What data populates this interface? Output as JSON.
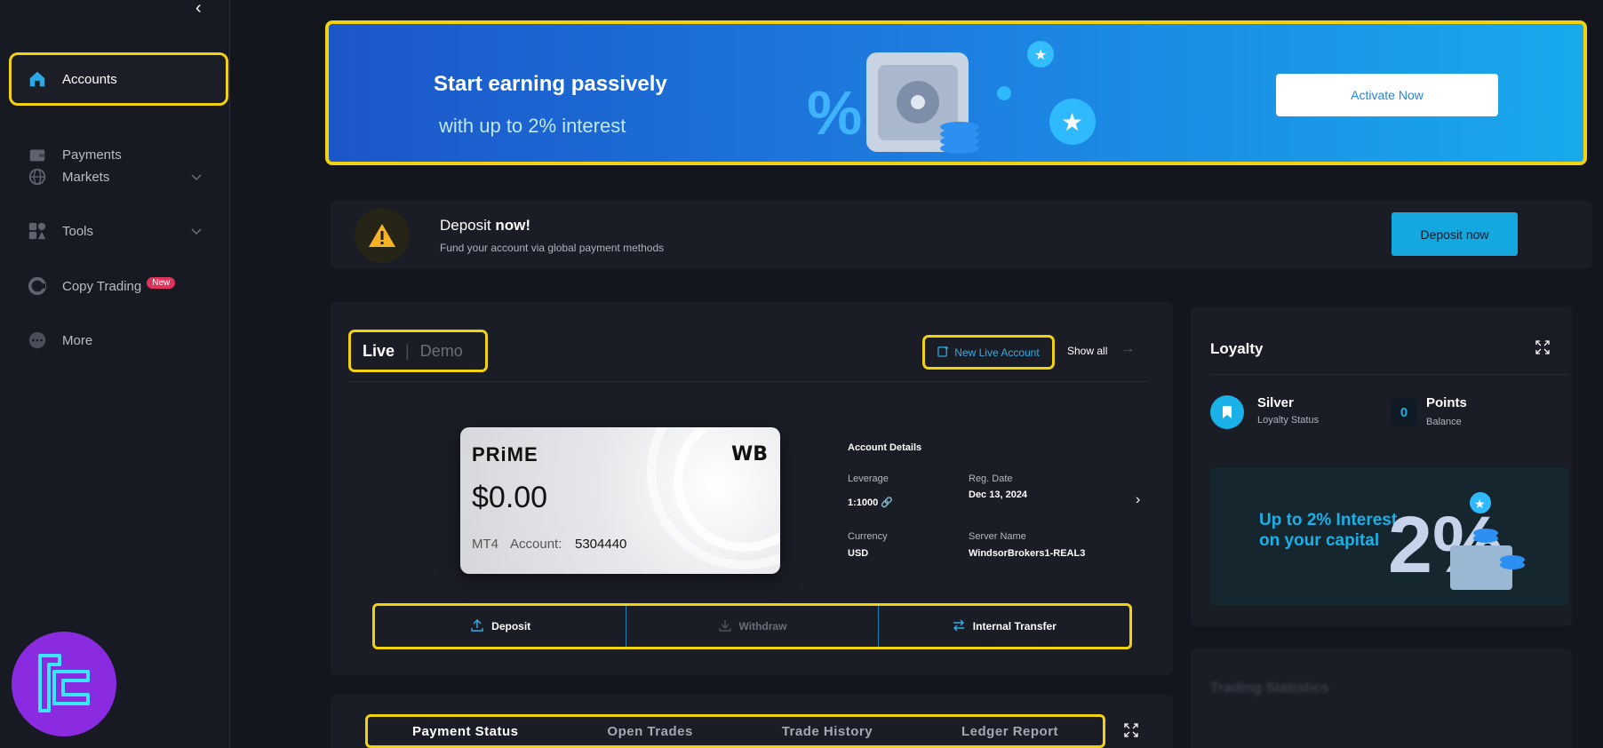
{
  "sidebar": {
    "collapse_glyph": "‹",
    "items": [
      {
        "label": "Accounts",
        "icon": "home-icon"
      },
      {
        "label": "Payments",
        "icon": "wallet-icon"
      },
      {
        "label": "Markets",
        "icon": "globe-icon"
      },
      {
        "label": "Tools",
        "icon": "tools-icon"
      },
      {
        "label": "Copy Trading",
        "icon": "copy-trading-icon",
        "badge": "New"
      },
      {
        "label": "More",
        "icon": "more-icon"
      }
    ]
  },
  "promo": {
    "title": "Start earning passively",
    "subtitle": "with up to 2% interest",
    "button": "Activate Now"
  },
  "deposit_banner": {
    "title_plain": "Deposit ",
    "title_bold": "now!",
    "subtitle": "Fund your account via global payment methods",
    "button": "Deposit now"
  },
  "accounts": {
    "tabs": {
      "live": "Live",
      "demo": "Demo"
    },
    "new_live_account": "New Live Account",
    "show_all": "Show all",
    "card": {
      "brand": "PRiME",
      "logo": "WB",
      "balance": "$0.00",
      "platform": "MT4",
      "account_label": "Account:",
      "account_number": "5304440"
    },
    "details": {
      "title": "Account Details",
      "leverage_label": "Leverage",
      "leverage_value": "1:1000",
      "reg_date_label": "Reg. Date",
      "reg_date_value": "Dec 13, 2024",
      "currency_label": "Currency",
      "currency_value": "USD",
      "server_label": "Server Name",
      "server_value": "WindsorBrokers1-REAL3"
    },
    "actions": {
      "deposit": "Deposit",
      "withdraw": "Withdraw",
      "internal_transfer": "Internal Transfer"
    }
  },
  "bottom_tabs": [
    "Payment Status",
    "Open Trades",
    "Trade History",
    "Ledger Report"
  ],
  "loyalty": {
    "title": "Loyalty",
    "status_value": "Silver",
    "status_label": "Loyalty Status",
    "points_value": "0",
    "points_title": "Points",
    "points_label": "Balance",
    "promo_text": "Up to 2% Interest on your capital",
    "promo_graphic": "2%"
  },
  "trading_statistics": {
    "title": "Trading Statistics"
  },
  "colors": {
    "highlight": "#f2d20e",
    "accent": "#15a7e0",
    "badge": "#e0335b",
    "logo": "#8a2be2"
  }
}
